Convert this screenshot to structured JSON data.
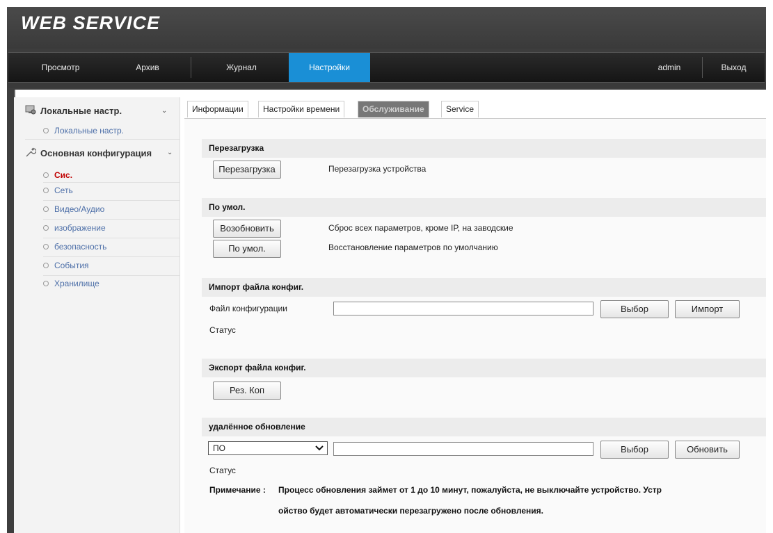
{
  "app": {
    "logo": "WEB SERVICE"
  },
  "nav": {
    "view": "Просмотр",
    "archive": "Архив",
    "log": "Журнал",
    "settings": "Настройки",
    "user": "admin",
    "logout": "Выход"
  },
  "sidebar": {
    "group1": {
      "label": "Локальные настр.",
      "items": [
        "Локальные настр."
      ]
    },
    "group2": {
      "label": "Основная конфигурация",
      "items": [
        "Сис.",
        "Сеть",
        "Видео/Аудио",
        "изображение",
        "безопасность",
        "События",
        "Хранилище"
      ],
      "active": "Сис."
    }
  },
  "tabs": [
    "Информации",
    "Настройки времени",
    "Обслуживание",
    "Service"
  ],
  "active_tab": "Обслуживание",
  "reboot": {
    "title": "Перезагрузка",
    "button": "Перезагрузка",
    "desc": "Перезагрузка устройства"
  },
  "defaults": {
    "title": "По умол.",
    "restore_button": "Возобновить",
    "restore_desc": "Сброс всех параметров, кроме IP, на заводские",
    "default_button": "По умол.",
    "default_desc": "Восстановление параметров по умолчанию"
  },
  "import": {
    "title": "Импорт файла конфиг.",
    "file_label": "Файл конфигурации",
    "file_value": "",
    "browse": "Выбор",
    "import_btn": "Импорт",
    "status_label": "Статус"
  },
  "export": {
    "title": "Экспорт файла конфиг.",
    "backup_btn": "Рез. Коп"
  },
  "upgrade": {
    "title": "удалённое обновление",
    "type_selected": "ПО",
    "file_value": "",
    "browse": "Выбор",
    "update_btn": "Обновить",
    "status_label": "Статус",
    "note_label": "Примечание :",
    "note_line1": "Процесс обновления займет от 1 до 10 минут, пожалуйста, не выключайте устройство. Устр",
    "note_line2": "ойство будет автоматически перезагружено после обновления."
  },
  "colors": {
    "accent": "#1a8fd6",
    "active_item": "#c00000",
    "link": "#4d6fa8"
  }
}
